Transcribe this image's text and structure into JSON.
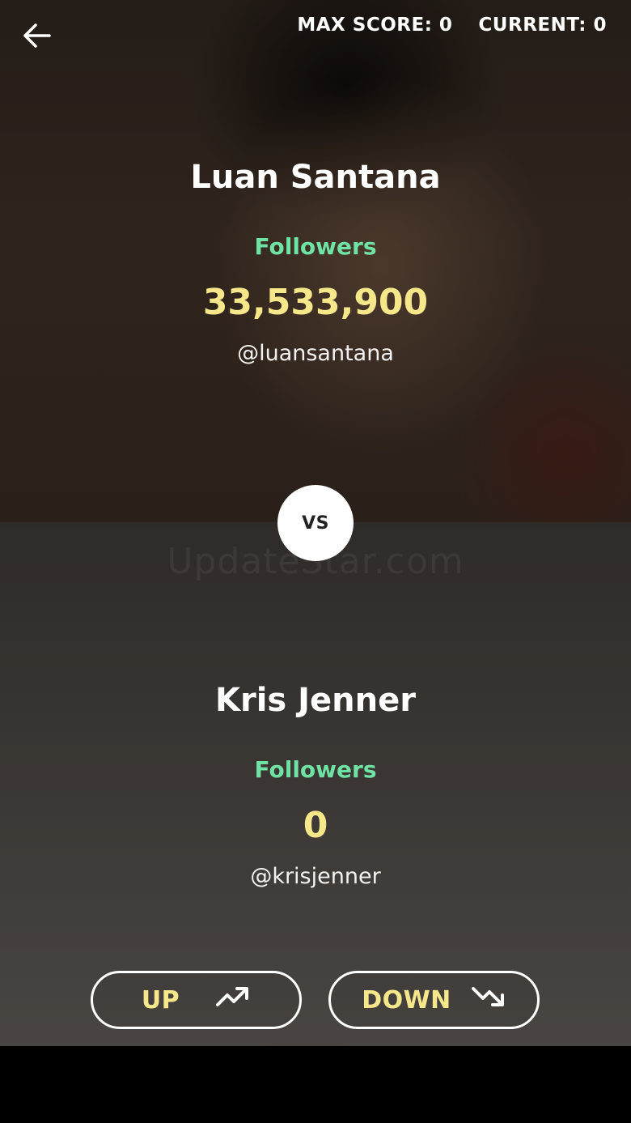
{
  "header": {
    "back_icon": "arrow-left-icon",
    "max_score_label": "MAX SCORE: 0",
    "current_label": "CURRENT: 0"
  },
  "top_card": {
    "name": "Luan Santana",
    "metric_label": "Followers",
    "count": "33,533,900",
    "handle": "@luansantana"
  },
  "vs_label": "VS",
  "watermark": "UpdateStar.com",
  "bottom_card": {
    "name": "Kris Jenner",
    "metric_label": "Followers",
    "count": "0",
    "handle": "@krisjenner"
  },
  "actions": {
    "up_label": "UP",
    "up_icon": "trending-up-icon",
    "down_label": "DOWN",
    "down_icon": "trending-down-icon"
  },
  "colors": {
    "metric": "#6fe3a4",
    "count": "#f6e88a",
    "text": "#ffffff"
  }
}
